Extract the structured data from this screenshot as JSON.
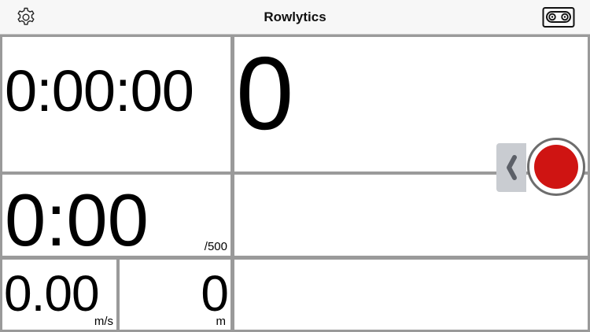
{
  "header": {
    "title": "Rowlytics",
    "left_icon": "gear-icon",
    "right_icon": "cassette-tape-icon"
  },
  "metrics": {
    "elapsed_time": "0:00:00",
    "stroke_count": "0",
    "split": "0:00",
    "split_unit": "/500",
    "speed": "0.00",
    "speed_unit": "m/s",
    "distance": "0",
    "distance_unit": "m"
  },
  "controls": {
    "drawer_handle_icon": "chevron-left-icon",
    "record_icon": "record-icon"
  },
  "colors": {
    "record_red": "#cf1412",
    "grid_line": "#9a9a9a",
    "navbar_bg": "#f7f7f7"
  }
}
